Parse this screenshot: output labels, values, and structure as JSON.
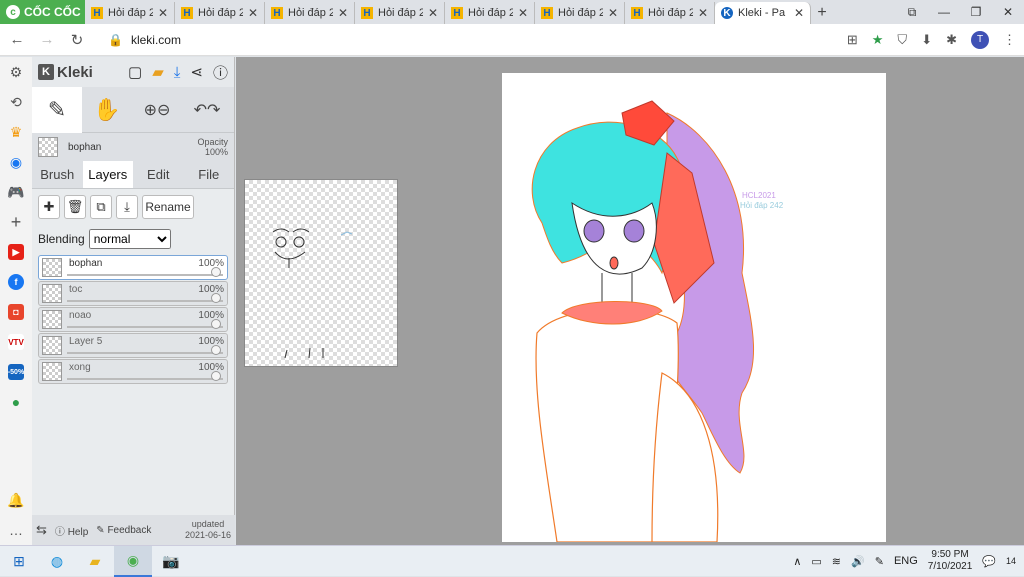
{
  "browser": {
    "brand": "CỐC CỐC",
    "tabs": [
      {
        "title": "Hỏi đáp 2"
      },
      {
        "title": "Hỏi đáp 2"
      },
      {
        "title": "Hỏi đáp 2"
      },
      {
        "title": "Hỏi đáp 2"
      },
      {
        "title": "Hỏi đáp 2"
      },
      {
        "title": "Hỏi đáp 2"
      },
      {
        "title": "Hỏi đáp 2"
      }
    ],
    "active_tab": {
      "title": "Kleki - Pa"
    },
    "url": "kleki.com",
    "profile_initial": "T"
  },
  "kleki": {
    "brand": "Kleki",
    "current_layer": "bophan",
    "opacity_label": "Opacity",
    "opacity_value": "100%",
    "tabs": [
      "Brush",
      "Layers",
      "Edit",
      "File"
    ],
    "active_tab": "Layers",
    "rename_label": "Rename",
    "blending_label": "Blending",
    "blending_value": "normal",
    "layers": [
      {
        "name": "bophan",
        "opacity": "100%",
        "active": true
      },
      {
        "name": "toc",
        "opacity": "100%",
        "active": false
      },
      {
        "name": "noao",
        "opacity": "100%",
        "active": false
      },
      {
        "name": "Layer 5",
        "opacity": "100%",
        "active": false
      },
      {
        "name": "xong",
        "opacity": "100%",
        "active": false
      }
    ],
    "footer": {
      "help": "Help",
      "feedback": "Feedback",
      "updated_label": "updated",
      "updated_date": "2021-06-16"
    }
  },
  "canvas": {
    "signature_line1": "HCL2021",
    "signature_line2": "Hỏi đáp 242"
  },
  "taskbar": {
    "language": "ENG",
    "time": "9:50 PM",
    "date": "7/10/2021",
    "notifications": "14"
  },
  "colors": {
    "hair": "#3ee3e0",
    "ponytail": "#c79ae8",
    "bow": "#ff4a3a",
    "sweater_outline": "#f07a2a",
    "collar": "#ff8078"
  }
}
